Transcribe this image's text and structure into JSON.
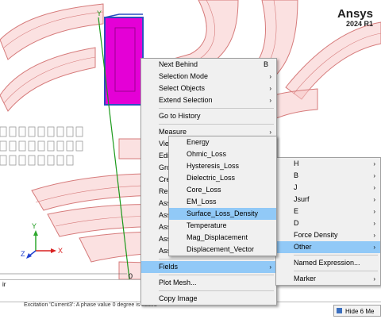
{
  "brand": {
    "name": "Ansys",
    "version": "2024 R1"
  },
  "axes": {
    "y": "Y",
    "x": "X",
    "z": "Z"
  },
  "ruler_value": "0",
  "bottom_tab": "ir",
  "message_text": "Excitation 'Current3': A phase value 0 degree is added",
  "hide_button": "Hide 6 Me",
  "menu": {
    "items": [
      {
        "label": "Next Behind",
        "shortcut": "B",
        "submenu": false
      },
      {
        "label": "Selection Mode",
        "submenu": true
      },
      {
        "label": "Select Objects",
        "submenu": true
      },
      {
        "label": "Extend Selection",
        "submenu": true
      },
      {
        "sep": true
      },
      {
        "label": "Go to History"
      },
      {
        "sep": true
      },
      {
        "label": "Measure",
        "submenu": true
      },
      {
        "label": "View"
      },
      {
        "label": "Edit"
      },
      {
        "label": "Gro"
      },
      {
        "label": "Cre"
      },
      {
        "label": "Rep"
      },
      {
        "label": "Ass"
      },
      {
        "label": "Ass"
      },
      {
        "label": "Ass"
      },
      {
        "label": "Ass"
      },
      {
        "label": "Assign Mesh Operation",
        "submenu": true
      },
      {
        "sep": true
      },
      {
        "label": "Fields",
        "submenu": true,
        "highlight": true
      },
      {
        "sep": true
      },
      {
        "label": "Plot Mesh..."
      },
      {
        "sep": true
      },
      {
        "label": "Copy Image"
      }
    ]
  },
  "fields_menu": {
    "items": [
      {
        "label": "H",
        "submenu": true
      },
      {
        "label": "B",
        "submenu": true
      },
      {
        "label": "J",
        "submenu": true
      },
      {
        "label": "Jsurf",
        "submenu": true
      },
      {
        "label": "E",
        "submenu": true
      },
      {
        "label": "D",
        "submenu": true
      },
      {
        "label": "Force Density",
        "submenu": true
      },
      {
        "label": "Other",
        "submenu": true,
        "highlight": true
      },
      {
        "sep": true
      },
      {
        "label": "Named Expression..."
      },
      {
        "sep": true
      },
      {
        "label": "Marker",
        "submenu": true
      }
    ]
  },
  "other_menu": {
    "items": [
      {
        "label": "Energy"
      },
      {
        "label": "Ohmic_Loss"
      },
      {
        "label": "Hysteresis_Loss"
      },
      {
        "label": "Dielectric_Loss"
      },
      {
        "label": "Core_Loss"
      },
      {
        "label": "EM_Loss"
      },
      {
        "label": "Surface_Loss_Density",
        "highlight": true
      },
      {
        "label": "Temperature"
      },
      {
        "label": "Mag_Displacement"
      },
      {
        "label": "Displacement_Vector"
      }
    ]
  },
  "colors": {
    "coil": "#f4b3b3",
    "coil_edge": "#d46a6a",
    "selected": "#e400d6",
    "highlight": "#91c9f7"
  }
}
